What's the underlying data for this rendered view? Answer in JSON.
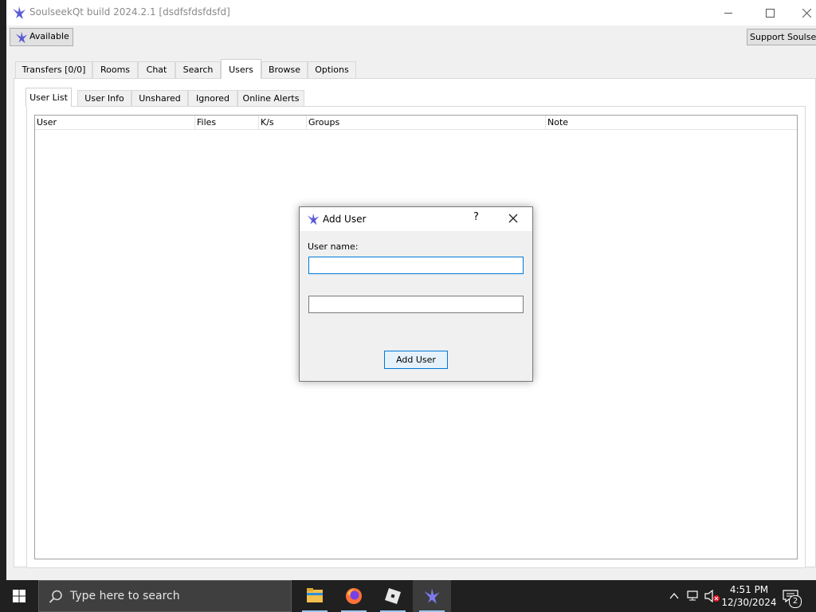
{
  "window": {
    "title": "SoulseekQt build 2024.2.1 [dsdfsfdsfdsfd]",
    "app_icon": "soulseek-bird-icon"
  },
  "toolbar": {
    "status_button": "Available",
    "support_button": "Support Soulseek"
  },
  "main_tabs": [
    {
      "label": "Transfers [0/0]"
    },
    {
      "label": "Rooms"
    },
    {
      "label": "Chat"
    },
    {
      "label": "Search"
    },
    {
      "label": "Users",
      "active": true
    },
    {
      "label": "Browse"
    },
    {
      "label": "Options"
    }
  ],
  "users_tabs": [
    {
      "label": "User List",
      "active": true
    },
    {
      "label": "User Info"
    },
    {
      "label": "Unshared"
    },
    {
      "label": "Ignored"
    },
    {
      "label": "Online Alerts"
    }
  ],
  "table": {
    "columns": [
      "User",
      "Files",
      "K/s",
      "Groups",
      "Note"
    ]
  },
  "dialog": {
    "title": "Add User",
    "help_label": "?",
    "user_name_label": "User name:",
    "user_name_value": "",
    "second_field_value": "",
    "add_button": "Add User"
  },
  "taskbar": {
    "search_placeholder": "Type here to search",
    "apps": [
      "file-explorer-icon",
      "firefox-icon",
      "roblox-icon",
      "soulseek-bird-icon"
    ],
    "time": "4:51 PM",
    "date": "12/30/2024",
    "notification_count": "2"
  },
  "colors": {
    "accent": "#0078d7",
    "bird": "#5b5bd6"
  }
}
